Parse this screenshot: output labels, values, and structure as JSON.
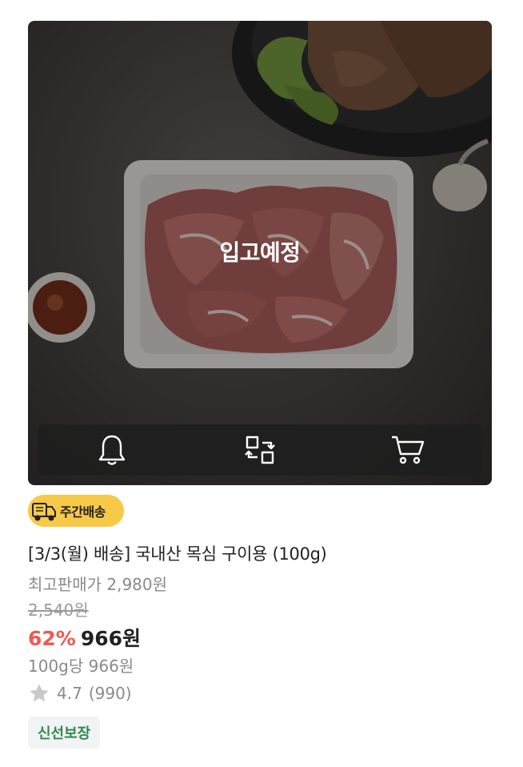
{
  "product": {
    "overlay_label": "입고예정",
    "badge_label": "주간배송",
    "title": "[3/3(월) 배송] 국내산 목심 구이용 (100g)",
    "max_price": "최고판매가 2,980원",
    "original_price": "2,540원",
    "discount": "62%",
    "sale_price": "966원",
    "unit_price": "100g당 966원",
    "rating": "4.7",
    "review_count": "(990)",
    "tag": "신선보장"
  },
  "actions": [
    {
      "icon": "bell-icon"
    },
    {
      "icon": "compare-icon"
    },
    {
      "icon": "cart-icon"
    }
  ],
  "colors": {
    "discount": "#ee5a52",
    "badge": "#f7c948",
    "tag_text": "#2f8a4e",
    "tag_bg": "#f1f3f4"
  }
}
